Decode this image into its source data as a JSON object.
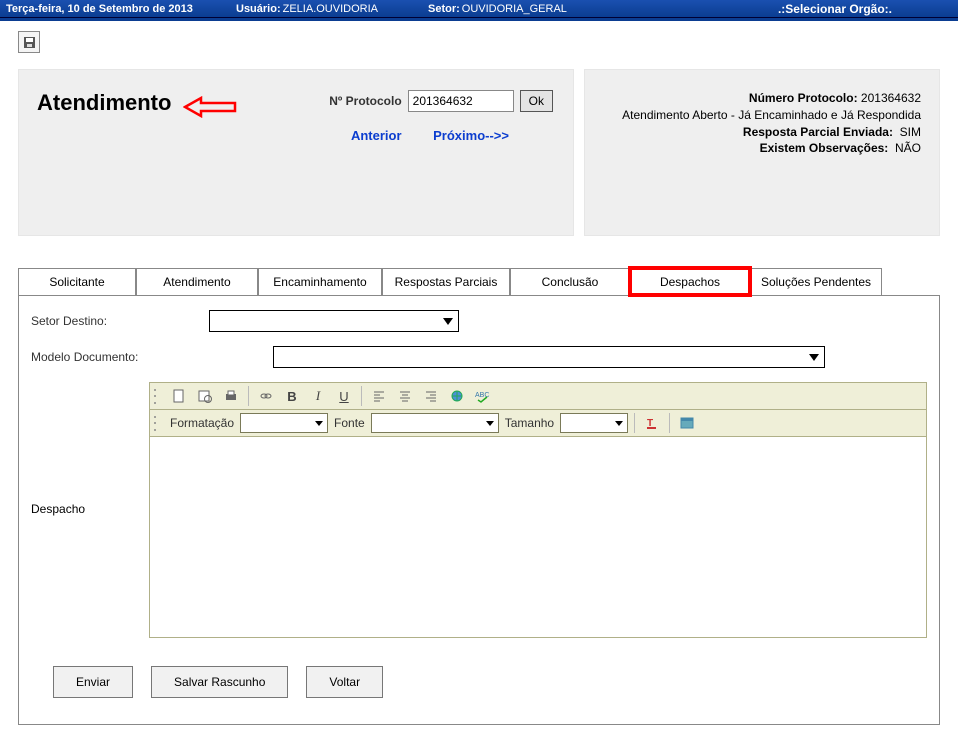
{
  "topbar": {
    "date": "Terça-feira, 10 de Setembro de 2013",
    "user_label": "Usuário:",
    "user_value": "ZELIA.OUVIDORIA",
    "sector_label": "Setor:",
    "sector_value": "OUVIDORIA_GERAL",
    "org_select": ".:Selecionar Orgão:."
  },
  "main": {
    "title": "Atendimento",
    "protocol_label": "Nº Protocolo",
    "protocol_value": "201364632",
    "ok": "Ok",
    "prev": "Anterior",
    "next": "Próximo-->>"
  },
  "info": {
    "l1_label": "Número Protocolo:",
    "l1_value": "201364632",
    "l2": "Atendimento Aberto - Já Encaminhado e Já Respondida",
    "l3_label": "Resposta Parcial Enviada:",
    "l3_value": "SIM",
    "l4_label": "Existem Observações:",
    "l4_value": "NÃO"
  },
  "tabs": {
    "t1": "Solicitante",
    "t2": "Atendimento",
    "t3": "Encaminhamento",
    "t4": "Respostas Parciais",
    "t5": "Conclusão",
    "t6": "Despachos",
    "t7": "Soluções Pendentes"
  },
  "form": {
    "setor_destino": "Setor Destino:",
    "modelo_doc": "Modelo Documento:",
    "despacho": "Despacho",
    "formatacao": "Formatação",
    "fonte": "Fonte",
    "tamanho": "Tamanho"
  },
  "buttons": {
    "enviar": "Enviar",
    "salvar": "Salvar Rascunho",
    "voltar": "Voltar"
  }
}
